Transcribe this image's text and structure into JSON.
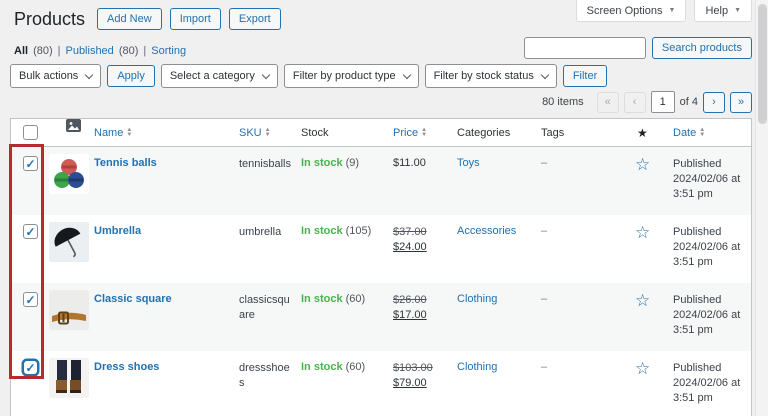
{
  "title": "Products",
  "header_buttons": {
    "add_new": "Add New",
    "import": "Import",
    "export": "Export"
  },
  "meta": {
    "screen_options": "Screen Options",
    "help": "Help"
  },
  "subnav": {
    "all": "All",
    "all_count": "(80)",
    "published": "Published",
    "published_count": "(80)",
    "sorting": "Sorting",
    "sep": "|"
  },
  "search": {
    "value": "",
    "button": "Search products"
  },
  "filters": {
    "bulk_actions": "Bulk actions",
    "apply": "Apply",
    "category": "Select a category",
    "product_type": "Filter by product type",
    "stock_status": "Filter by stock status",
    "filter": "Filter"
  },
  "pagination": {
    "count": "80 items",
    "first": "«",
    "prev": "‹",
    "current": "1",
    "of": "of 4",
    "next": "›",
    "last": "»"
  },
  "table": {
    "headers": {
      "name": "Name",
      "sku": "SKU",
      "stock": "Stock",
      "price": "Price",
      "categories": "Categories",
      "tags": "Tags",
      "star": "★",
      "date": "Date"
    },
    "rows": [
      {
        "name": "Tennis balls",
        "sku": "tennisballs",
        "stock_status": "In stock",
        "stock_qty": "(9)",
        "price": "$11.00",
        "category": "Toys",
        "tags": "–",
        "date1": "Published",
        "date2": "2024/02/06 at",
        "date3": "3:51 pm"
      },
      {
        "name": "Umbrella",
        "sku": "umbrella",
        "stock_status": "In stock",
        "stock_qty": "(105)",
        "price_old": "$37.00",
        "price_new": "$24.00",
        "category": "Accessories",
        "tags": "–",
        "date1": "Published",
        "date2": "2024/02/06 at",
        "date3": "3:51 pm"
      },
      {
        "name": "Classic square",
        "sku": "classicsquare",
        "stock_status": "In stock",
        "stock_qty": "(60)",
        "price_old": "$26.00",
        "price_new": "$17.00",
        "category": "Clothing",
        "tags": "–",
        "date1": "Published",
        "date2": "2024/02/06 at",
        "date3": "3:51 pm"
      },
      {
        "name": "Dress shoes",
        "sku": "dressshoes",
        "stock_status": "In stock",
        "stock_qty": "(60)",
        "price_old": "$103.00",
        "price_new": "$79.00",
        "category": "Clothing",
        "tags": "–",
        "date1": "Published",
        "date2": "2024/02/06 at",
        "date3": "3:51 pm"
      }
    ]
  },
  "icons": {
    "sort_asc": "▲",
    "sort_desc": "▼",
    "caret_down": "▼",
    "check": "✓",
    "star_outline": "☆",
    "star_filled": "★"
  },
  "colors": {
    "accent_blue": "#2271b1",
    "in_stock_green": "#4cb24c",
    "annotation_red": "#b32d2e",
    "page_bg": "#f0f0f1"
  }
}
